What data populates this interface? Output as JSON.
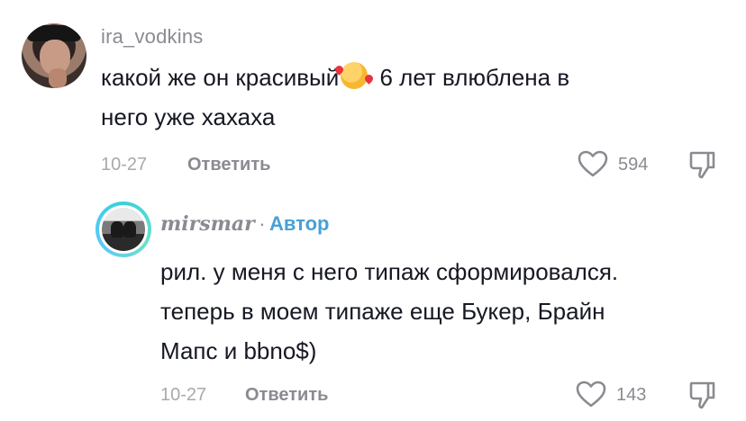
{
  "comments": [
    {
      "username": "ira_vodkins",
      "text_line1_a": "какой же он красивый",
      "emoji": "smiling-face-with-hearts-icon",
      "text_line1_b": " 6 лет влюблена в",
      "text_line2": "него уже хахаха",
      "date": "10-27",
      "reply_label": "Ответить",
      "likes": "594"
    },
    {
      "username": "mirsmar",
      "separator": "·",
      "author_label": "Автор",
      "text_line1": "рил. у меня с него типаж сформировался.",
      "text_line2": "теперь в моем типаже еще Букер, Брайн",
      "text_line3": "Мапс и bbno$)",
      "date": "10-27",
      "reply_label": "Ответить",
      "likes": "143"
    }
  ],
  "icons": {
    "like": "heart-outline-icon",
    "dislike": "thumbs-down-outline-icon"
  },
  "colors": {
    "text": "#161823",
    "muted": "#8a8b91",
    "author_badge": "#48a0d8"
  }
}
